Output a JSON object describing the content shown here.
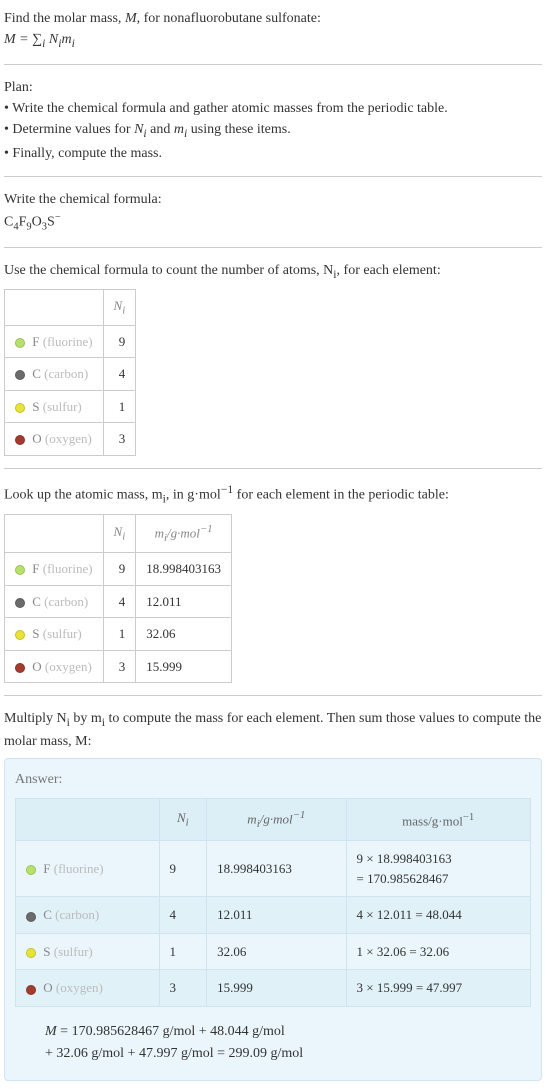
{
  "intro": {
    "line1": "Find the molar mass, M, for nonafluorobutane sulfonate:",
    "formula_html": "M = ∑<sub>i</sub> N<sub>i</sub>m<sub>i</sub>"
  },
  "plan": {
    "title": "Plan:",
    "items": [
      "• Write the chemical formula and gather atomic masses from the periodic table.",
      "• Determine values for Nᵢ and mᵢ using these items.",
      "• Finally, compute the mass."
    ]
  },
  "step1": {
    "title": "Write the chemical formula:",
    "formula_html": "C<sub>4</sub>F<sub>9</sub>O<sub>3</sub>S<sup>−</sup>"
  },
  "step2": {
    "title_html": "Use the chemical formula to count the number of atoms, N<sub>i</sub>, for each element:",
    "headers": {
      "ni_html": "N<sub>i</sub>"
    },
    "rows": [
      {
        "color": "#b7e26a",
        "sym": "F",
        "name": "(fluorine)",
        "n": "9"
      },
      {
        "color": "#6b6b6b",
        "sym": "C",
        "name": "(carbon)",
        "n": "4"
      },
      {
        "color": "#e8e337",
        "sym": "S",
        "name": "(sulfur)",
        "n": "1"
      },
      {
        "color": "#a33b2f",
        "sym": "O",
        "name": "(oxygen)",
        "n": "3"
      }
    ]
  },
  "step3": {
    "title_html": "Look up the atomic mass, m<sub>i</sub>, in g·mol<sup>−1</sup> for each element in the periodic table:",
    "headers": {
      "ni_html": "N<sub>i</sub>",
      "mi_html": "m<sub>i</sub>/g·mol<sup>−1</sup>"
    },
    "rows": [
      {
        "color": "#b7e26a",
        "sym": "F",
        "name": "(fluorine)",
        "n": "9",
        "m": "18.998403163"
      },
      {
        "color": "#6b6b6b",
        "sym": "C",
        "name": "(carbon)",
        "n": "4",
        "m": "12.011"
      },
      {
        "color": "#e8e337",
        "sym": "S",
        "name": "(sulfur)",
        "n": "1",
        "m": "32.06"
      },
      {
        "color": "#a33b2f",
        "sym": "O",
        "name": "(oxygen)",
        "n": "3",
        "m": "15.999"
      }
    ]
  },
  "step4": {
    "title_html": "Multiply N<sub>i</sub> by m<sub>i</sub> to compute the mass for each element. Then sum those values to compute the molar mass, M:"
  },
  "answer": {
    "label": "Answer:",
    "headers": {
      "ni_html": "N<sub>i</sub>",
      "mi_html": "m<sub>i</sub>/g·mol<sup>−1</sup>",
      "mass_html": "mass/g·mol<sup>−1</sup>"
    },
    "rows": [
      {
        "color": "#b7e26a",
        "sym": "F",
        "name": "(fluorine)",
        "n": "9",
        "m": "18.998403163",
        "mass_html": "9 × 18.998403163<br>= 170.985628467"
      },
      {
        "color": "#6b6b6b",
        "sym": "C",
        "name": "(carbon)",
        "n": "4",
        "m": "12.011",
        "mass_html": "4 × 12.011 = 48.044"
      },
      {
        "color": "#e8e337",
        "sym": "S",
        "name": "(sulfur)",
        "n": "1",
        "m": "32.06",
        "mass_html": "1 × 32.06 = 32.06"
      },
      {
        "color": "#a33b2f",
        "sym": "O",
        "name": "(oxygen)",
        "n": "3",
        "m": "15.999",
        "mass_html": "3 × 15.999 = 47.997"
      }
    ],
    "result_line1": "M = 170.985628467 g/mol + 48.044 g/mol",
    "result_line2": "+ 32.06 g/mol + 47.997 g/mol = 299.09 g/mol"
  }
}
